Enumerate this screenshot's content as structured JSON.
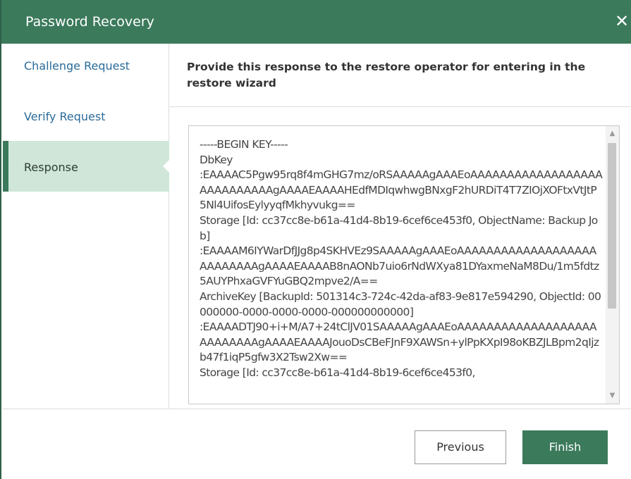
{
  "window": {
    "title": "Password Recovery",
    "close_icon": "close-icon"
  },
  "sidebar": {
    "steps": [
      {
        "label": "Challenge Request"
      },
      {
        "label": "Verify Request"
      },
      {
        "label": "Response"
      }
    ]
  },
  "main": {
    "heading": "Provide this response to the restore operator for entering in the restore wizard",
    "key_text": "-----BEGIN KEY-----\nDbKey\n:EAAAAC5Pgw95rq8f4mGHG7mz/oRSAAAAAgAAAEoAAAAAAAAAAAAAAAAAAAAAAAAAAAAgAAAAEAAAAHEdfMDIqwhwgBNxgF2hURDiT4T7ZIOjXOFtxVtJtP5Nl4UifosEylyyqfMkhyvukg==\nStorage [Id: cc37cc8e-b61a-41d4-8b19-6cef6ce453f0, ObjectName: Backup Job]\n:EAAAAM6IYWarDfJJg8p4SKHVEz9SAAAAAgAAAEoAAAAAAAAAAAAAAAAAAAAAAAAAAAgAAAAEAAAAB8nAONb7uio6rNdWXya81DYaxmeNaM8Du/1m5fdtz5AUYPhxaGVFYuGBQ2mpve2/A==\nArchiveKey [BackupId: 501314c3-724c-42da-af83-9e817e594290, ObjectId: 00000000-0000-0000-0000-000000000000]\n:EAAAADTJ90+i+M/A7+24tClJV01SAAAAAgAAAEoAAAAAAAAAAAAAAAAAAAAAAAAAAAgAAAAEAAAAJouoDsCBeFJnF9XAWSn+ylPpKXpI98oKBZJLBpm2qIjzb47f1iqP5gfw3X2Tsw2Xw==\nStorage [Id: cc37cc8e-b61a-41d4-8b19-6cef6ce453f0,"
  },
  "footer": {
    "previous_label": "Previous",
    "finish_label": "Finish"
  },
  "colors": {
    "accent": "#3b7a5b",
    "selected_step_bg": "#cfe6d8",
    "link": "#2a6b9a"
  }
}
